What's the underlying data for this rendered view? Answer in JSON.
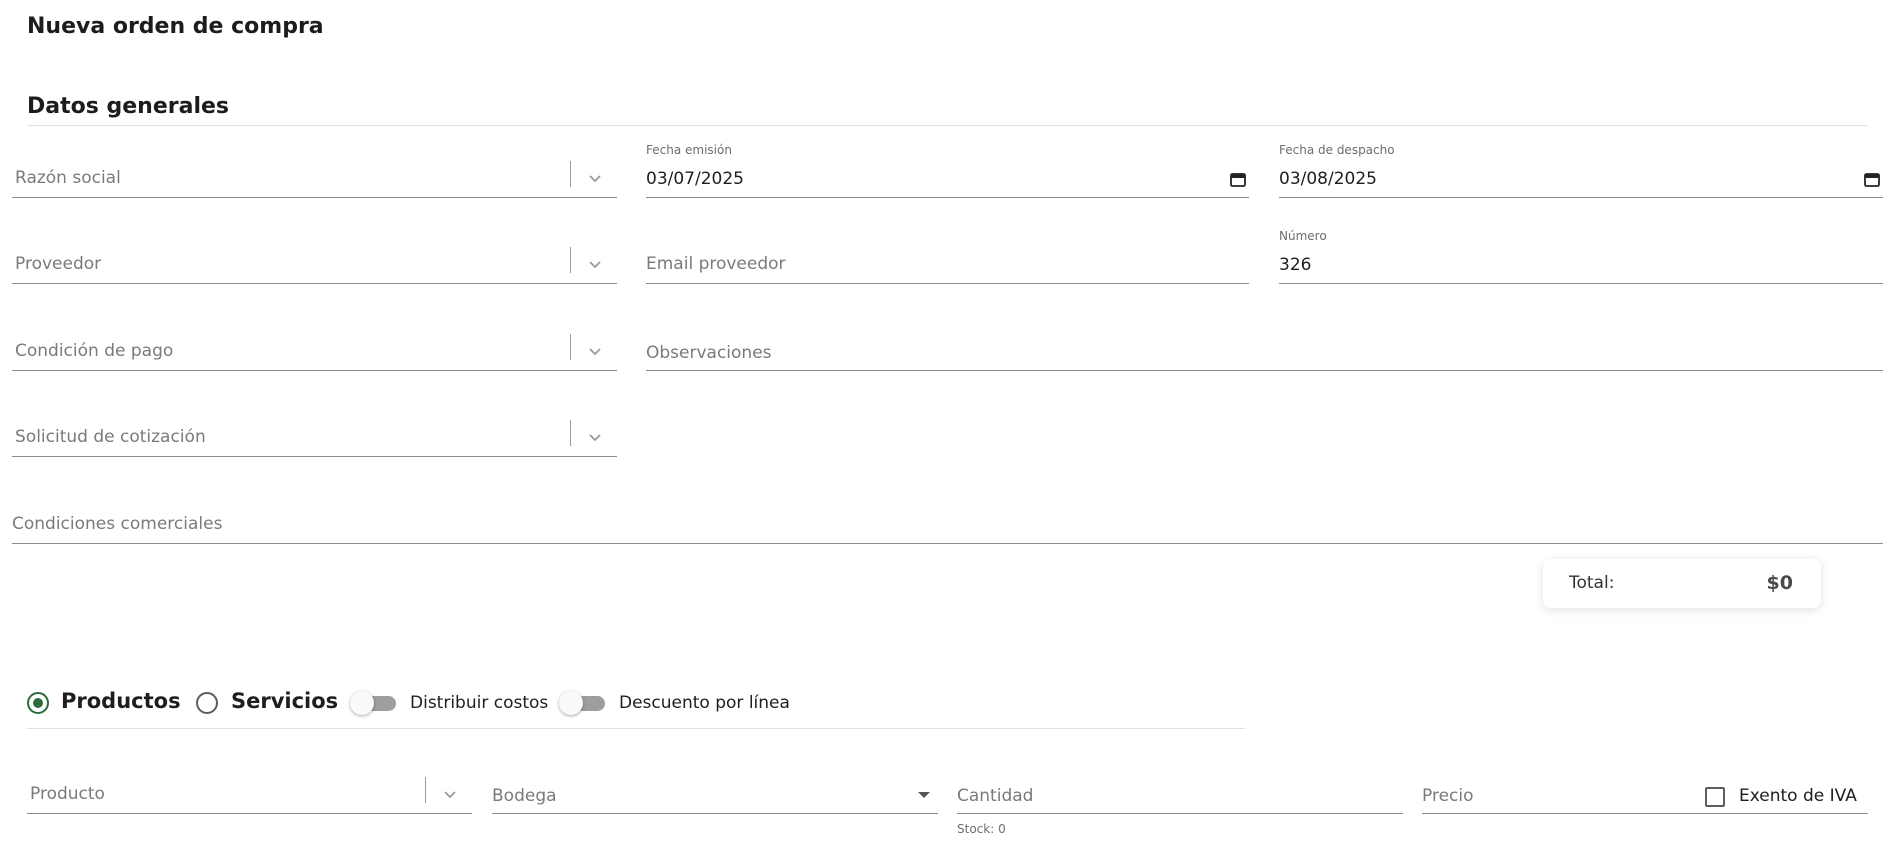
{
  "page": {
    "title": "Nueva orden de compra"
  },
  "general": {
    "title": "Datos generales",
    "razon_social": {
      "placeholder": "Razón social"
    },
    "fecha_emision": {
      "label": "Fecha emisión",
      "value": "03/07/2025"
    },
    "fecha_despacho": {
      "label": "Fecha de despacho",
      "value": "03/08/2025"
    },
    "proveedor": {
      "placeholder": "Proveedor"
    },
    "email_proveedor": {
      "placeholder": "Email proveedor"
    },
    "numero": {
      "label": "Número",
      "value": "326"
    },
    "condicion_pago": {
      "placeholder": "Condición de pago"
    },
    "observaciones": {
      "placeholder": "Observaciones"
    },
    "solicitud_cotizacion": {
      "placeholder": "Solicitud de cotización"
    },
    "condiciones_comerciales": {
      "placeholder": "Condiciones comerciales"
    }
  },
  "total": {
    "label": "Total:",
    "amount": "$0"
  },
  "mode": {
    "productos_label": "Productos",
    "servicios_label": "Servicios",
    "selected": "Productos",
    "distribuir_costos_label": "Distribuir costos",
    "distribuir_costos_on": false,
    "descuento_linea_label": "Descuento por línea",
    "descuento_linea_on": false
  },
  "line": {
    "producto": {
      "placeholder": "Producto"
    },
    "bodega": {
      "placeholder": "Bodega"
    },
    "cantidad": {
      "placeholder": "Cantidad"
    },
    "stock_text": "Stock: 0",
    "precio": {
      "placeholder": "Precio"
    },
    "exento_iva_label": "Exento de IVA",
    "exento_iva_checked": false
  },
  "icons": {
    "chevron": "chevron-down-icon",
    "calendar": "calendar-icon",
    "dropdown": "dropdown-arrow-icon"
  },
  "colors": {
    "accent": "#2e6b3a",
    "underline": "#8c8c8c",
    "placeholder": "#7a7a7a"
  }
}
